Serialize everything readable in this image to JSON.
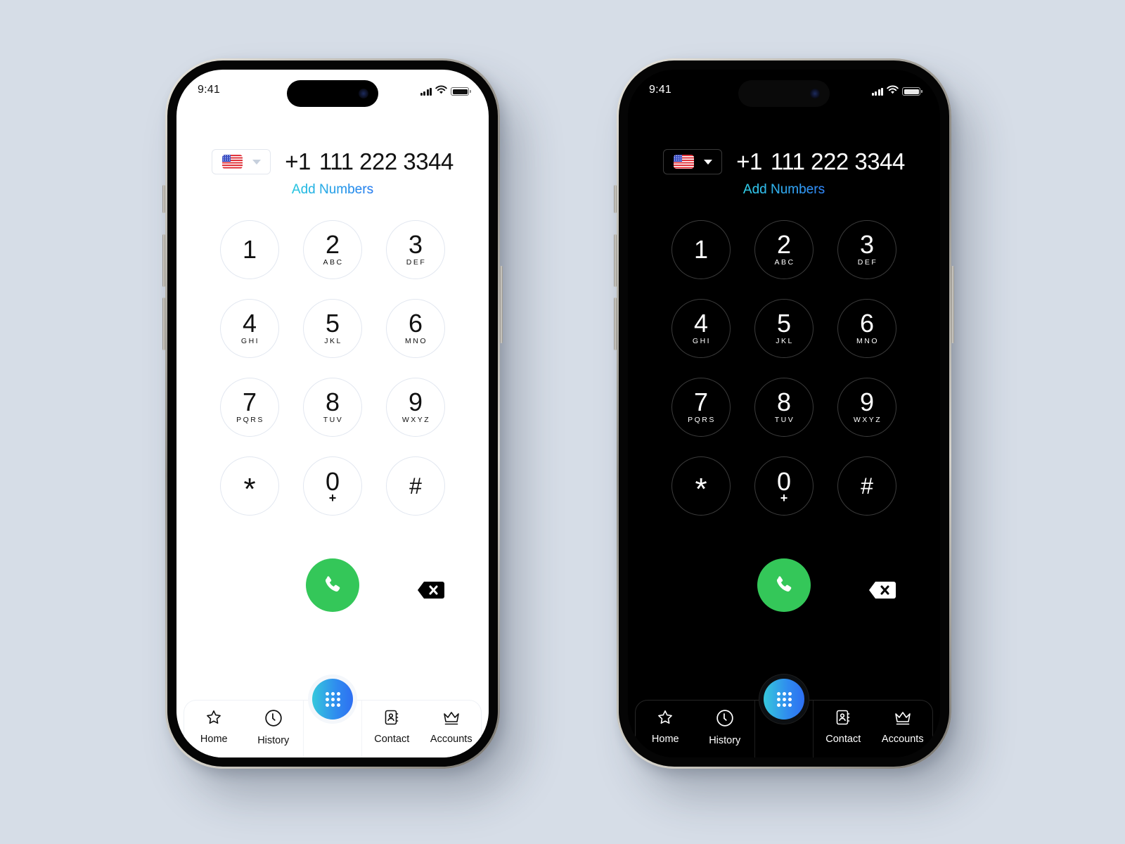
{
  "screens": [
    {
      "theme": "light",
      "status_bar": {
        "time": "9:41"
      },
      "dialer": {
        "country": {
          "flag_icon": "us-flag-icon",
          "code": "+1"
        },
        "number": "111 222 3344",
        "add_numbers_label": "Add Numbers"
      },
      "keypad": [
        {
          "digit": "1",
          "letters": ""
        },
        {
          "digit": "2",
          "letters": "ABC"
        },
        {
          "digit": "3",
          "letters": "DEF"
        },
        {
          "digit": "4",
          "letters": "GHI"
        },
        {
          "digit": "5",
          "letters": "JKL"
        },
        {
          "digit": "6",
          "letters": "MNO"
        },
        {
          "digit": "7",
          "letters": "PQRS"
        },
        {
          "digit": "8",
          "letters": "TUV"
        },
        {
          "digit": "9",
          "letters": "WXYZ"
        },
        {
          "digit": "*",
          "letters": ""
        },
        {
          "digit": "0",
          "letters": "+"
        },
        {
          "digit": "#",
          "letters": ""
        }
      ],
      "tabs": [
        {
          "label": "Home",
          "icon": "star-icon"
        },
        {
          "label": "History",
          "icon": "clock-icon"
        },
        {
          "label": "Contact",
          "icon": "contact-book-icon"
        },
        {
          "label": "Accounts",
          "icon": "crown-icon"
        }
      ]
    },
    {
      "theme": "dark",
      "status_bar": {
        "time": "9:41"
      },
      "dialer": {
        "country": {
          "flag_icon": "us-flag-icon",
          "code": "+1"
        },
        "number": "111 222 3344",
        "add_numbers_label": "Add Numbers"
      },
      "keypad": [
        {
          "digit": "1",
          "letters": ""
        },
        {
          "digit": "2",
          "letters": "ABC"
        },
        {
          "digit": "3",
          "letters": "DEF"
        },
        {
          "digit": "4",
          "letters": "GHI"
        },
        {
          "digit": "5",
          "letters": "JKL"
        },
        {
          "digit": "6",
          "letters": "MNO"
        },
        {
          "digit": "7",
          "letters": "PQRS"
        },
        {
          "digit": "8",
          "letters": "TUV"
        },
        {
          "digit": "9",
          "letters": "WXYZ"
        },
        {
          "digit": "*",
          "letters": ""
        },
        {
          "digit": "0",
          "letters": "+"
        },
        {
          "digit": "#",
          "letters": ""
        }
      ],
      "tabs": [
        {
          "label": "Home",
          "icon": "star-icon"
        },
        {
          "label": "History",
          "icon": "clock-icon"
        },
        {
          "label": "Contact",
          "icon": "contact-book-icon"
        },
        {
          "label": "Accounts",
          "icon": "crown-icon"
        }
      ]
    }
  ],
  "colors": {
    "background": "#d6dde7",
    "call_green": "#34c759",
    "accent_gradient_start": "#2fcbe0",
    "accent_gradient_end": "#2f7ef0"
  }
}
